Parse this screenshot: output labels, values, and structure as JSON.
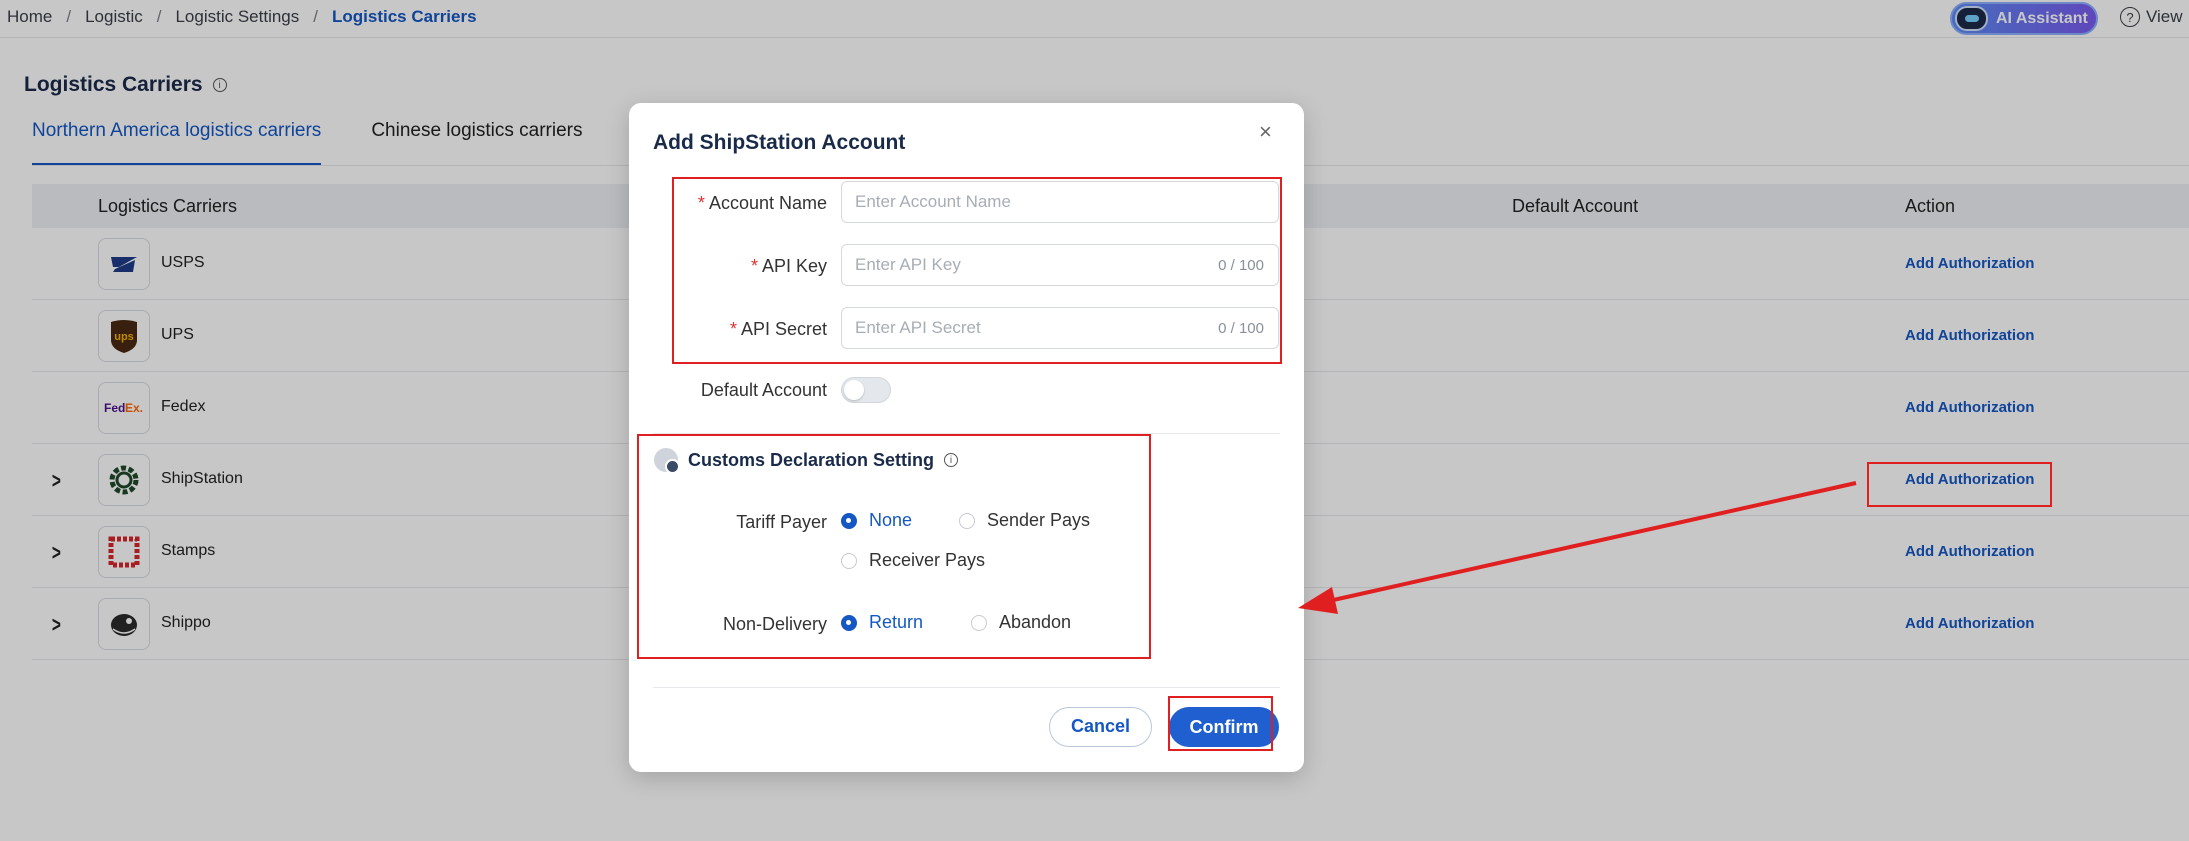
{
  "breadcrumb": {
    "home": "Home",
    "logistic": "Logistic",
    "settings": "Logistic Settings",
    "current": "Logistics Carriers",
    "sep": "/"
  },
  "header": {
    "ai_assistant": "AI Assistant",
    "view": "View"
  },
  "page": {
    "title": "Logistics Carriers",
    "tabs": [
      "Northern America logistics carriers",
      "Chinese logistics carriers"
    ]
  },
  "table": {
    "columns": [
      "Logistics Carriers",
      "Default Account",
      "Action"
    ],
    "rows": [
      {
        "name": "USPS",
        "action": "Add Authorization"
      },
      {
        "name": "UPS",
        "action": "Add Authorization"
      },
      {
        "name": "Fedex",
        "action": "Add Authorization"
      },
      {
        "name": "ShipStation",
        "action": "Add Authorization"
      },
      {
        "name": "Stamps",
        "action": "Add Authorization"
      },
      {
        "name": "Shippo",
        "action": "Add Authorization"
      }
    ]
  },
  "modal": {
    "title": "Add ShipStation Account",
    "close": "×",
    "fields": {
      "account_name": {
        "label": "Account Name",
        "placeholder": "Enter Account Name"
      },
      "api_key": {
        "label": "API Key",
        "placeholder": "Enter API Key",
        "counter": "0 / 100"
      },
      "api_secret": {
        "label": "API Secret",
        "placeholder": "Enter API Secret",
        "counter": "0 / 100"
      },
      "default_account": {
        "label": "Default Account",
        "checked": false
      }
    },
    "customs": {
      "title": "Customs Declaration Setting",
      "tariff_label": "Tariff Payer",
      "tariff_options": [
        "None",
        "Sender Pays",
        "Receiver Pays"
      ],
      "tariff_selected": "None",
      "nondelivery_label": "Non-Delivery",
      "nondelivery_options": [
        "Return",
        "Abandon"
      ],
      "nondelivery_selected": "Return"
    },
    "cancel": "Cancel",
    "confirm": "Confirm"
  },
  "colors": {
    "primary": "#1558c4",
    "annotation": "#e02020",
    "ups_brown": "#4a2a12",
    "ups_gold": "#f5b400",
    "fedex_purple": "#4d148c",
    "fedex_orange": "#ff6600"
  },
  "icons": {
    "info": "info-icon",
    "help": "help-icon",
    "chevron": "chevron-right-icon",
    "close": "close-icon"
  }
}
